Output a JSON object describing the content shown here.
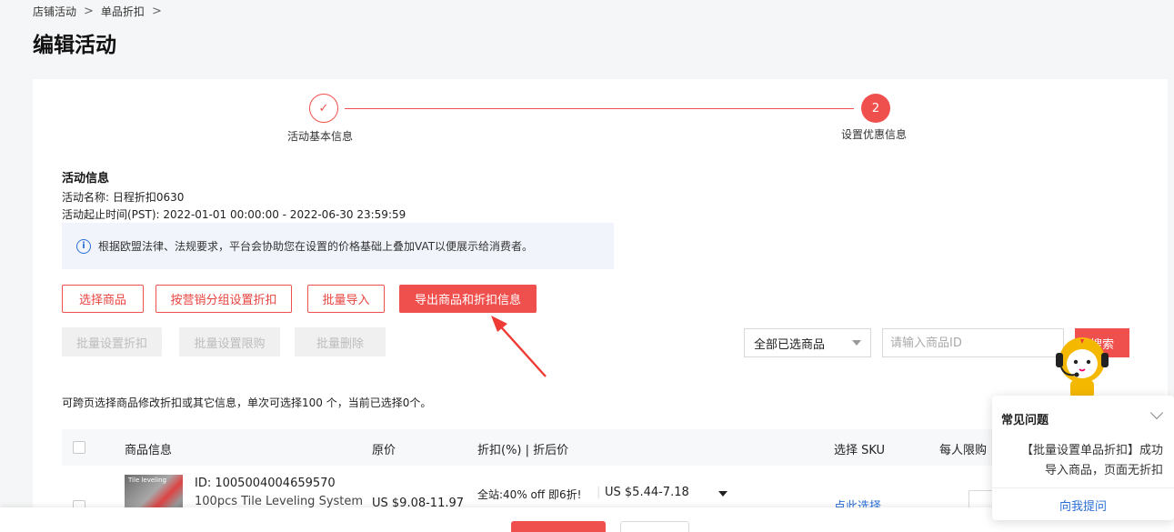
{
  "breadcrumb": {
    "item1": "店铺活动",
    "item2": "单品折扣",
    "sep": ">"
  },
  "page_title": "编辑活动",
  "steps": {
    "step1_label": "活动基本信息",
    "step2_label": "设置优惠信息",
    "step2_number": "2",
    "step1_mark": "✓"
  },
  "activity_info": {
    "title": "活动信息",
    "name_line": "活动名称:  日程折扣0630",
    "time_line": "活动起止时间(PST):  2022-01-01 00:00:00 - 2022-06-30 23:59:59"
  },
  "notice": {
    "icon_glyph": "i",
    "text": "根据欧盟法律、法规要求，平台会协助您在设置的价格基础上叠加VAT以便展示给消费者。"
  },
  "buttons": {
    "select_goods": "选择商品",
    "group_discount": "按营销分组设置折扣",
    "batch_import": "批量导入",
    "export": "导出商品和折扣信息",
    "batch_discount": "批量设置折扣",
    "batch_limit": "批量设置限购",
    "batch_delete": "批量删除"
  },
  "filter": {
    "select_value": "全部已选商品",
    "search_placeholder": "请输入商品ID",
    "search_label": "搜索"
  },
  "tip": "可跨页选择商品修改折扣或其它信息，单次可选择100 个，当前已选择0个。",
  "table": {
    "headers": {
      "info": "商品信息",
      "price": "原价",
      "discount": "折扣(%) | 折后价",
      "sku": "选择 SKU",
      "limit": "每人限购"
    },
    "rows": [
      {
        "thumb_text": "Tile leveling",
        "id": "ID: 1005004004659570",
        "name": "100pcs Tile Leveling System",
        "price": "US $9.08-11.97",
        "discount": "全站:40% off 即6折!",
        "discount_price": "US $5.44-7.18",
        "sku_link": "点此选择"
      }
    ]
  },
  "faq": {
    "title": "常见问题",
    "text": "【批量设置单品折扣】成功导入商品，页面无折扣",
    "link": "向我提问"
  },
  "colors": {
    "accent": "#f0504d",
    "link": "#2a6fd6"
  }
}
